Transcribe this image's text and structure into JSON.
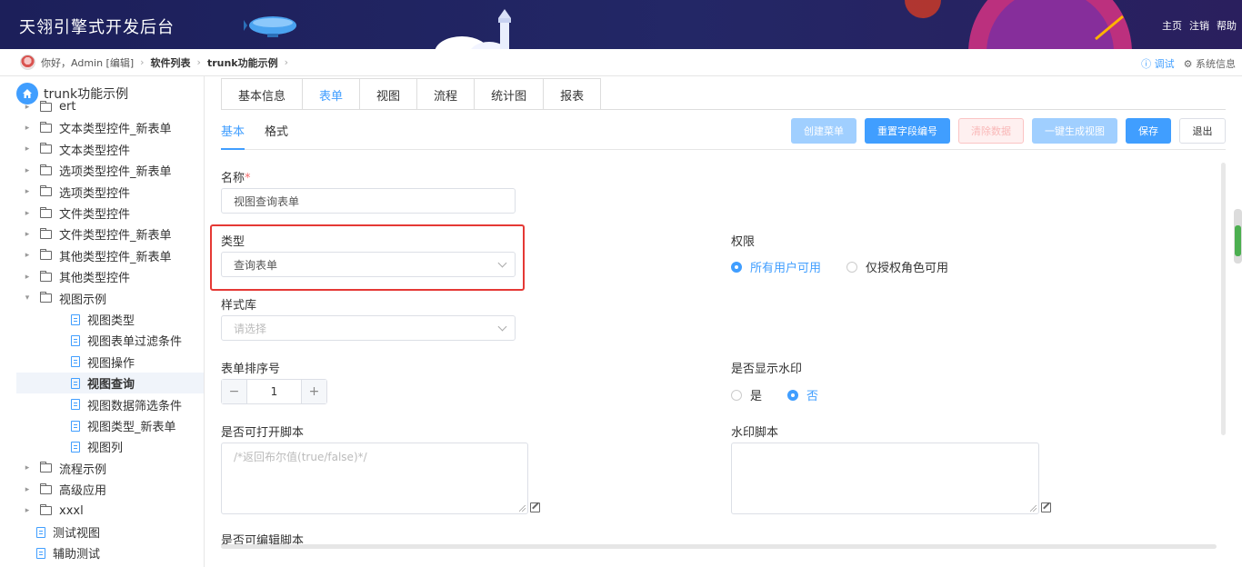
{
  "header": {
    "brand": "天翎引擎式开发后台",
    "links": [
      "主页",
      "注销",
      "帮助"
    ]
  },
  "breadcrumb": {
    "greeting": "你好，Admin [编辑]",
    "items": [
      "软件列表",
      "trunk功能示例"
    ],
    "right": {
      "debug": "ⓘ 调试",
      "system": "⚙ 系统信息"
    }
  },
  "sidebar": {
    "root": "trunk功能示例",
    "items": [
      {
        "label": "ert",
        "type": "folder"
      },
      {
        "label": "文本类型控件_新表单",
        "type": "folder"
      },
      {
        "label": "文本类型控件",
        "type": "folder"
      },
      {
        "label": "选项类型控件_新表单",
        "type": "folder"
      },
      {
        "label": "选项类型控件",
        "type": "folder"
      },
      {
        "label": "文件类型控件",
        "type": "folder"
      },
      {
        "label": "文件类型控件_新表单",
        "type": "folder"
      },
      {
        "label": "其他类型控件_新表单",
        "type": "folder"
      },
      {
        "label": "其他类型控件",
        "type": "folder"
      },
      {
        "label": "视图示例",
        "type": "folder-open"
      },
      {
        "label": "视图类型",
        "type": "doc"
      },
      {
        "label": "视图表单过滤条件",
        "type": "doc"
      },
      {
        "label": "视图操作",
        "type": "doc"
      },
      {
        "label": "视图查询",
        "type": "doc",
        "active": true
      },
      {
        "label": "视图数据筛选条件",
        "type": "doc"
      },
      {
        "label": "视图类型_新表单",
        "type": "doc"
      },
      {
        "label": "视图列",
        "type": "doc"
      },
      {
        "label": "流程示例",
        "type": "folder"
      },
      {
        "label": "高级应用",
        "type": "folder"
      },
      {
        "label": "xxxl",
        "type": "folder"
      },
      {
        "label": "测试视图",
        "type": "doc"
      },
      {
        "label": "辅助测试",
        "type": "doc"
      }
    ]
  },
  "tabs": [
    "基本信息",
    "表单",
    "视图",
    "流程",
    "统计图",
    "报表"
  ],
  "subtabs": [
    "基本",
    "格式"
  ],
  "buttons": {
    "create_menu": "创建菜单",
    "reset_field_no": "重置字段编号",
    "clear_data": "清除数据",
    "gen_view": "一键生成视图",
    "save": "保存",
    "exit": "退出"
  },
  "form": {
    "name_label": "名称",
    "name_required": "*",
    "name_value": "视图查询表单",
    "type_label": "类型",
    "type_value": "查询表单",
    "permission_label": "权限",
    "permission_options": [
      "所有用户可用",
      "仅授权角色可用"
    ],
    "style_label": "样式库",
    "style_placeholder": "请选择",
    "sort_label": "表单排序号",
    "sort_value": "1",
    "watermark_label": "是否显示水印",
    "watermark_options": [
      "是",
      "否"
    ],
    "open_script_label": "是否可打开脚本",
    "open_script_placeholder": "/*返回布尔值(true/false)*/",
    "watermark_script_label": "水印脚本",
    "edit_script_label": "是否可编辑脚本"
  },
  "colors": {
    "accent": "#409eff",
    "highlight": "#e53935"
  }
}
